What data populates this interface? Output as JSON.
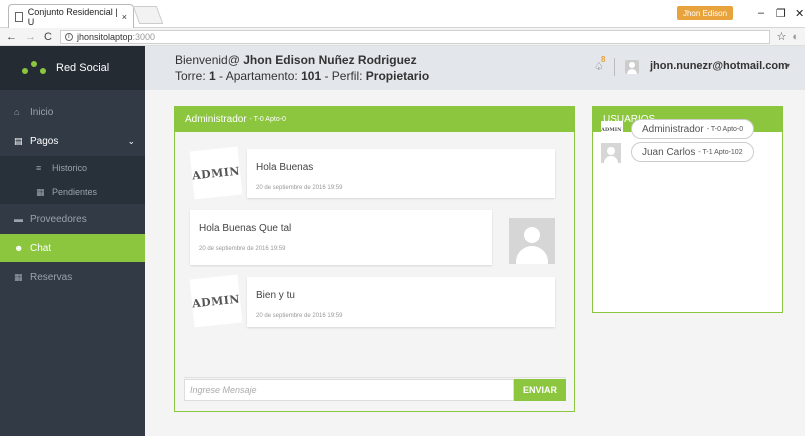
{
  "browser": {
    "tab_title": "Conjunto Residencial | U",
    "tab_close": "×",
    "profile_name": "Jhon Edison",
    "url_host": "jhonsitolaptop",
    "url_port": ":3000"
  },
  "brand": {
    "name": "Red Social"
  },
  "sidebar": {
    "items": [
      {
        "label": "Inicio",
        "icon": "home-icon"
      },
      {
        "label": "Pagos",
        "icon": "document-icon"
      },
      {
        "label": "Historico",
        "icon": "list-icon"
      },
      {
        "label": "Pendientes",
        "icon": "table-icon"
      },
      {
        "label": "Proveedores",
        "icon": "truck-icon"
      },
      {
        "label": "Chat",
        "icon": "users-icon",
        "active": true
      },
      {
        "label": "Reservas",
        "icon": "calendar-icon"
      }
    ]
  },
  "header": {
    "welcome_prefix": "Bienvenid@ ",
    "user_full_name": "Jhon Edison Nuñez Rodriguez",
    "torre_label": "Torre: ",
    "torre_value": "1",
    "apto_label": " - Apartamento: ",
    "apto_value": "101",
    "perfil_label": " - Perfil: ",
    "perfil_value": "Propietario",
    "notification_count": "8",
    "email": "jhon.nunezr@hotmail.com"
  },
  "chat": {
    "title": "Administrador",
    "title_sub": " - T-0 Apto-0",
    "messages": [
      {
        "text": "Hola Buenas",
        "date": "20 de septiembre de 2016 19:59",
        "side": "left",
        "avatar": "ADMIN"
      },
      {
        "text": "Hola Buenas Que tal",
        "date": "20 de septiembre de 2016 19:59",
        "side": "right"
      },
      {
        "text": "Bien y tu",
        "date": "20 de septiembre de 2016 19:59",
        "side": "left",
        "avatar": "ADMIN"
      }
    ],
    "input_placeholder": "Ingrese Mensaje",
    "send_label": "ENVIAR"
  },
  "users": {
    "title": "USUARIOS",
    "list": [
      {
        "name": "Administrador",
        "sub": "- T-0 Apto-0",
        "avatar": "ADMIN"
      },
      {
        "name": "Juan Carlos",
        "sub": "- T-1 Apto-102"
      }
    ]
  },
  "colors": {
    "accent": "#8cc63f",
    "sidebar": "#313a45",
    "brand_bg": "#242b33"
  }
}
